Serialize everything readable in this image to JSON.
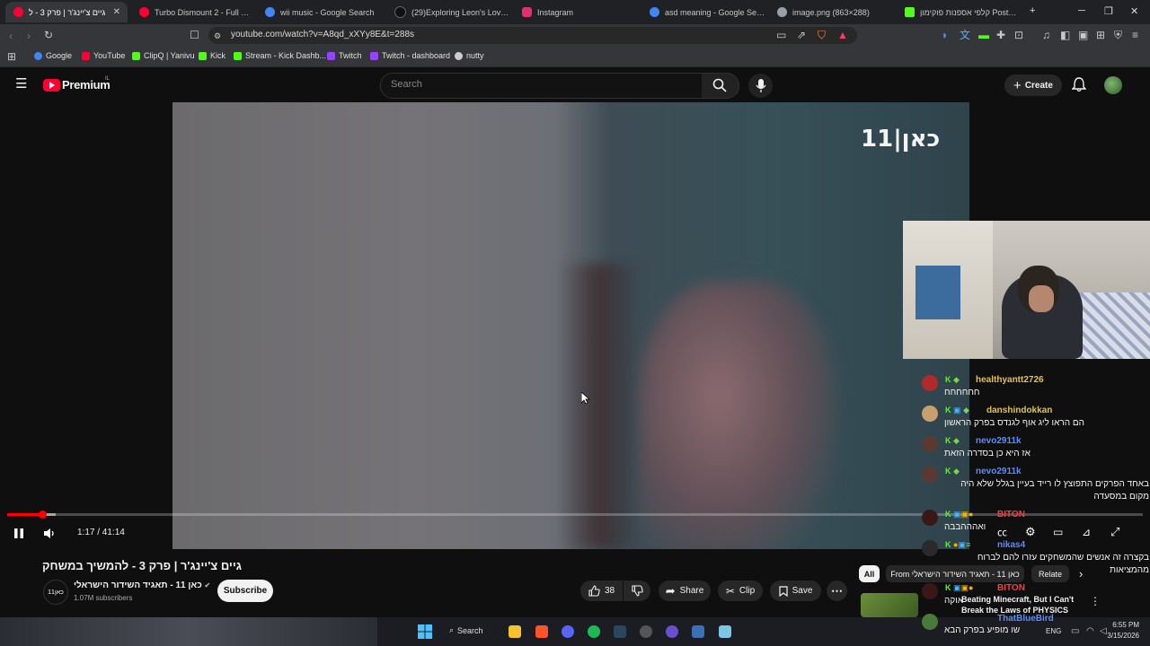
{
  "browser": {
    "tabs": [
      {
        "title": "גיים צ'יינג'ר | פרק 3 - ל",
        "color": "#ff0033"
      },
      {
        "title": "Turbo Dismount 2 - Full Relea",
        "color": "#ff0033"
      },
      {
        "title": "wii music - Google Search",
        "color": "#4285f4"
      },
      {
        "title": "(29)Exploring Leon's Love Inte",
        "color": "#111111"
      },
      {
        "title": "Instagram",
        "color": "#e1306c"
      },
      {
        "title": "asd meaning - Google Search",
        "color": "#4285f4"
      },
      {
        "title": "image.png (863×288)",
        "color": "#9aa0a6"
      },
      {
        "title": "קלפי אספנות פוקימון Poster Box",
        "color": "#53fc18"
      }
    ],
    "url": "youtube.com/watch?v=A8qd_xXYy8E&t=288s",
    "bookmarks": [
      {
        "label": "Google",
        "color": "#4285f4"
      },
      {
        "label": "YouTube",
        "color": "#ff0033"
      },
      {
        "label": "ClipQ | Yanivu",
        "color": "#53fc18"
      },
      {
        "label": "Kick",
        "color": "#53fc18"
      },
      {
        "label": "Stream - Kick Dashb...",
        "color": "#53fc18"
      },
      {
        "label": "Twitch",
        "color": "#9146ff"
      },
      {
        "label": "Twitch - dashboard",
        "color": "#9146ff"
      },
      {
        "label": "nutty",
        "color": "#cccccc"
      }
    ]
  },
  "youtube": {
    "logo_text": "Premium",
    "logo_superscript": "IL",
    "search_placeholder": "Search",
    "create_label": "Create",
    "video_overlay_logo": "כאן|11",
    "time_display": "1:17 / 41:14",
    "progress_fraction": 0.031,
    "video_title": "גיים צ'יינג'ר | פרק 3 - להמשיך במשחק",
    "channel_name": "כאן 11 - תאגיד השידור הישראלי",
    "channel_avatar_text": "כאן11",
    "subscribers": "1.07M subscribers",
    "subscribe_label": "Subscribe",
    "likes": "38",
    "share_label": "Share",
    "clip_label": "Clip",
    "save_label": "Save",
    "chips": [
      "All",
      "From כאן 11 - תאגיד השידור הישראלי",
      "Relate"
    ],
    "related_title": "Beating Minecraft, But I Can't Break the Laws of PHYSICS"
  },
  "chat": [
    {
      "user": "healthyantt2726",
      "user_color": "#e6c34a",
      "msg": "חחחחחח",
      "avatar": "#b02a2a"
    },
    {
      "user": "danshindokkan",
      "user_color": "#e6c34a",
      "msg": "הם הראו ליג אוף לגנדס בפרק הראשון",
      "avatar": "#c8a070"
    },
    {
      "user": "nevo2911k",
      "user_color": "#5b8cff",
      "msg": "אז היא כן בסדרה הזאת",
      "avatar": "#5a3a30"
    },
    {
      "user": "nevo2911k",
      "user_color": "#5b8cff",
      "msg": "באחד הפרקים התפוצץ לו רייד בעיין בגלל שלא היה מקום במסעדה",
      "avatar": "#5a3a30"
    },
    {
      "user": "BITON",
      "user_color": "#ff3b3b",
      "msg": "ואהההבבה",
      "avatar": "#3a1818"
    },
    {
      "user": "nikas4",
      "user_color": "#5b8cff",
      "msg": "בקצרה זה אנשים שהמשחקים עזרו להם לברוח מהמציאות",
      "avatar": "#2a2a2a"
    },
    {
      "user": "BITON",
      "user_color": "#ff3b3b",
      "msg": "אוקה",
      "avatar": "#3a1818"
    },
    {
      "user": "ThatBlueBird",
      "user_color": "#5b8cff",
      "msg": "שו מופיע בפרק הבא",
      "avatar": "#4a7a3a"
    }
  ],
  "taskbar": {
    "search_label": "Search",
    "language": "ENG",
    "time": "6:55 PM",
    "date": "3/15/2026"
  }
}
